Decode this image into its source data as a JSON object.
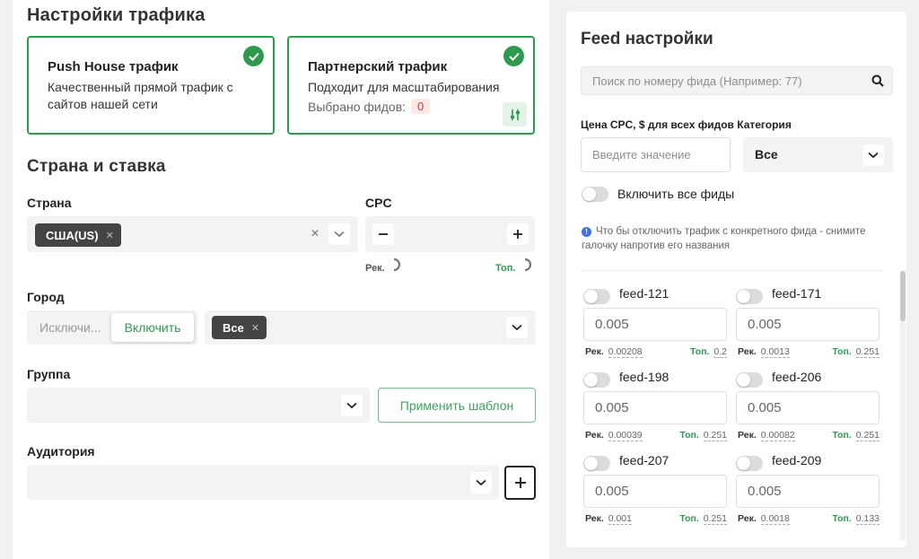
{
  "traffic": {
    "title": "Настройки трафика",
    "push": {
      "title": "Push House трафик",
      "desc": "Качественный прямой трафик с сайтов нашей сети"
    },
    "partner": {
      "title": "Партнерский трафик",
      "desc": "Подходит для масштабирования",
      "selected_label": "Выбрано фидов:",
      "selected_count": "0"
    }
  },
  "country_rate": {
    "title": "Страна и ставка",
    "country_label": "Страна",
    "country_chip": "США(US)",
    "cpc_label": "CPC",
    "rec_label": "Рек.",
    "top_label": "Топ."
  },
  "city": {
    "label": "Город",
    "exclude": "Исключи...",
    "include": "Включить",
    "chip": "Все"
  },
  "group": {
    "label": "Группа",
    "apply_template": "Применить шаблон"
  },
  "audience": {
    "label": "Аудитория"
  },
  "feed_settings": {
    "title": "Feed настройки",
    "search_placeholder": "Поиск по номеру фида (Например: 77)",
    "cpc_label": "Цена CPC, $ для всех фидов Категория",
    "value_placeholder": "Введите значение",
    "category_value": "Все",
    "enable_all": "Включить все фиды",
    "info": "Что бы отключить трафик с конкретного фида - снимите галочку напротив его названия",
    "rec_label": "Рек.",
    "top_label": "Топ.",
    "feeds": [
      {
        "name": "feed-121",
        "value": "0.005",
        "rec": "0.00208",
        "top": "0.2"
      },
      {
        "name": "feed-171",
        "value": "0.005",
        "rec": "0.0013",
        "top": "0.251"
      },
      {
        "name": "feed-198",
        "value": "0.005",
        "rec": "0.00039",
        "top": "0.251"
      },
      {
        "name": "feed-206",
        "value": "0.005",
        "rec": "0.00082",
        "top": "0.251"
      },
      {
        "name": "feed-207",
        "value": "0.005",
        "rec": "0.001",
        "top": "0.251"
      },
      {
        "name": "feed-209",
        "value": "0.005",
        "rec": "0.0018",
        "top": "0.133"
      }
    ]
  },
  "colors": {
    "accent": "#2f9a4f",
    "badge": "#d0383a",
    "chip": "#444444"
  }
}
